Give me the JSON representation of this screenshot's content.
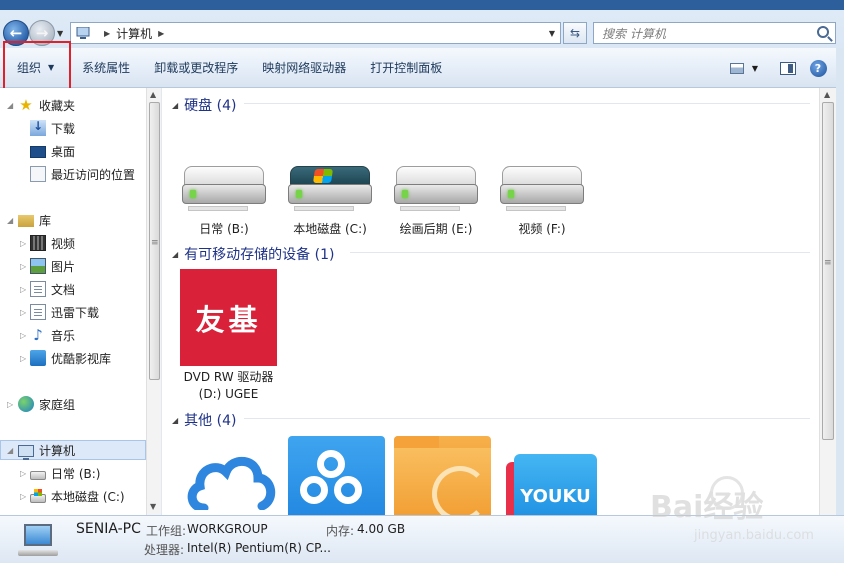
{
  "address_bar": {
    "breadcrumb": "计算机",
    "search_placeholder": "搜索 计算机"
  },
  "toolbar": {
    "organize": "组织",
    "system_properties": "系统属性",
    "uninstall": "卸载或更改程序",
    "map_drive": "映射网络驱动器",
    "control_panel": "打开控制面板"
  },
  "nav": {
    "favorites": "收藏夹",
    "downloads": "下载",
    "desktop": "桌面",
    "recent": "最近访问的位置",
    "libraries": "库",
    "videos": "视频",
    "pictures": "图片",
    "documents": "文档",
    "xunlei": "迅雷下载",
    "music": "音乐",
    "youku_video": "优酷影视库",
    "homegroup": "家庭组",
    "computer": "计算机",
    "drive_b": "日常 (B:)",
    "drive_c": "本地磁盘 (C:)"
  },
  "groups": {
    "hard_disks": "硬盘 (4)",
    "removable": "有可移动存储的设备 (1)",
    "other": "其他 (4)"
  },
  "drives": [
    {
      "label": "日常 (B:)"
    },
    {
      "label": "本地磁盘 (C:)"
    },
    {
      "label": "绘画后期 (E:)"
    },
    {
      "label": "视频 (F:)"
    }
  ],
  "dvd": {
    "logo_text": "友基",
    "label_line1": "DVD RW 驱动器",
    "label_line2": "(D:) UGEE"
  },
  "apps": {
    "youku_logo": "YOUKU"
  },
  "details": {
    "pc_name": "SENIA-PC",
    "workgroup_label": "工作组:",
    "workgroup_value": "WORKGROUP",
    "memory_label": "内存:",
    "memory_value": "4.00 GB",
    "cpu_label": "处理器:",
    "cpu_value": "Intel(R) Pentium(R) CP..."
  },
  "watermark": {
    "brand": "Bai经验",
    "url": "jingyan.baidu.com"
  }
}
